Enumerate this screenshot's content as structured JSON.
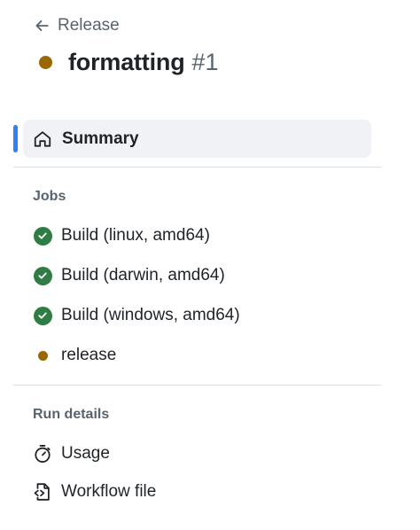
{
  "header": {
    "back_label": "Release",
    "run_title": "formatting",
    "run_number": "#1",
    "status": "in_progress",
    "status_color": "#9a6700"
  },
  "nav": {
    "summary_label": "Summary",
    "active_indicator_color": "#2f81f7"
  },
  "jobs": {
    "heading": "Jobs",
    "items": [
      {
        "label": "Build (linux, amd64)",
        "status": "success"
      },
      {
        "label": "Build (darwin, amd64)",
        "status": "success"
      },
      {
        "label": "Build (windows, amd64)",
        "status": "success"
      },
      {
        "label": "release",
        "status": "in_progress"
      }
    ],
    "success_color": "#2f7d45"
  },
  "run_details": {
    "heading": "Run details",
    "items": [
      {
        "label": "Usage",
        "icon": "stopwatch-icon"
      },
      {
        "label": "Workflow file",
        "icon": "file-code-icon"
      }
    ]
  }
}
